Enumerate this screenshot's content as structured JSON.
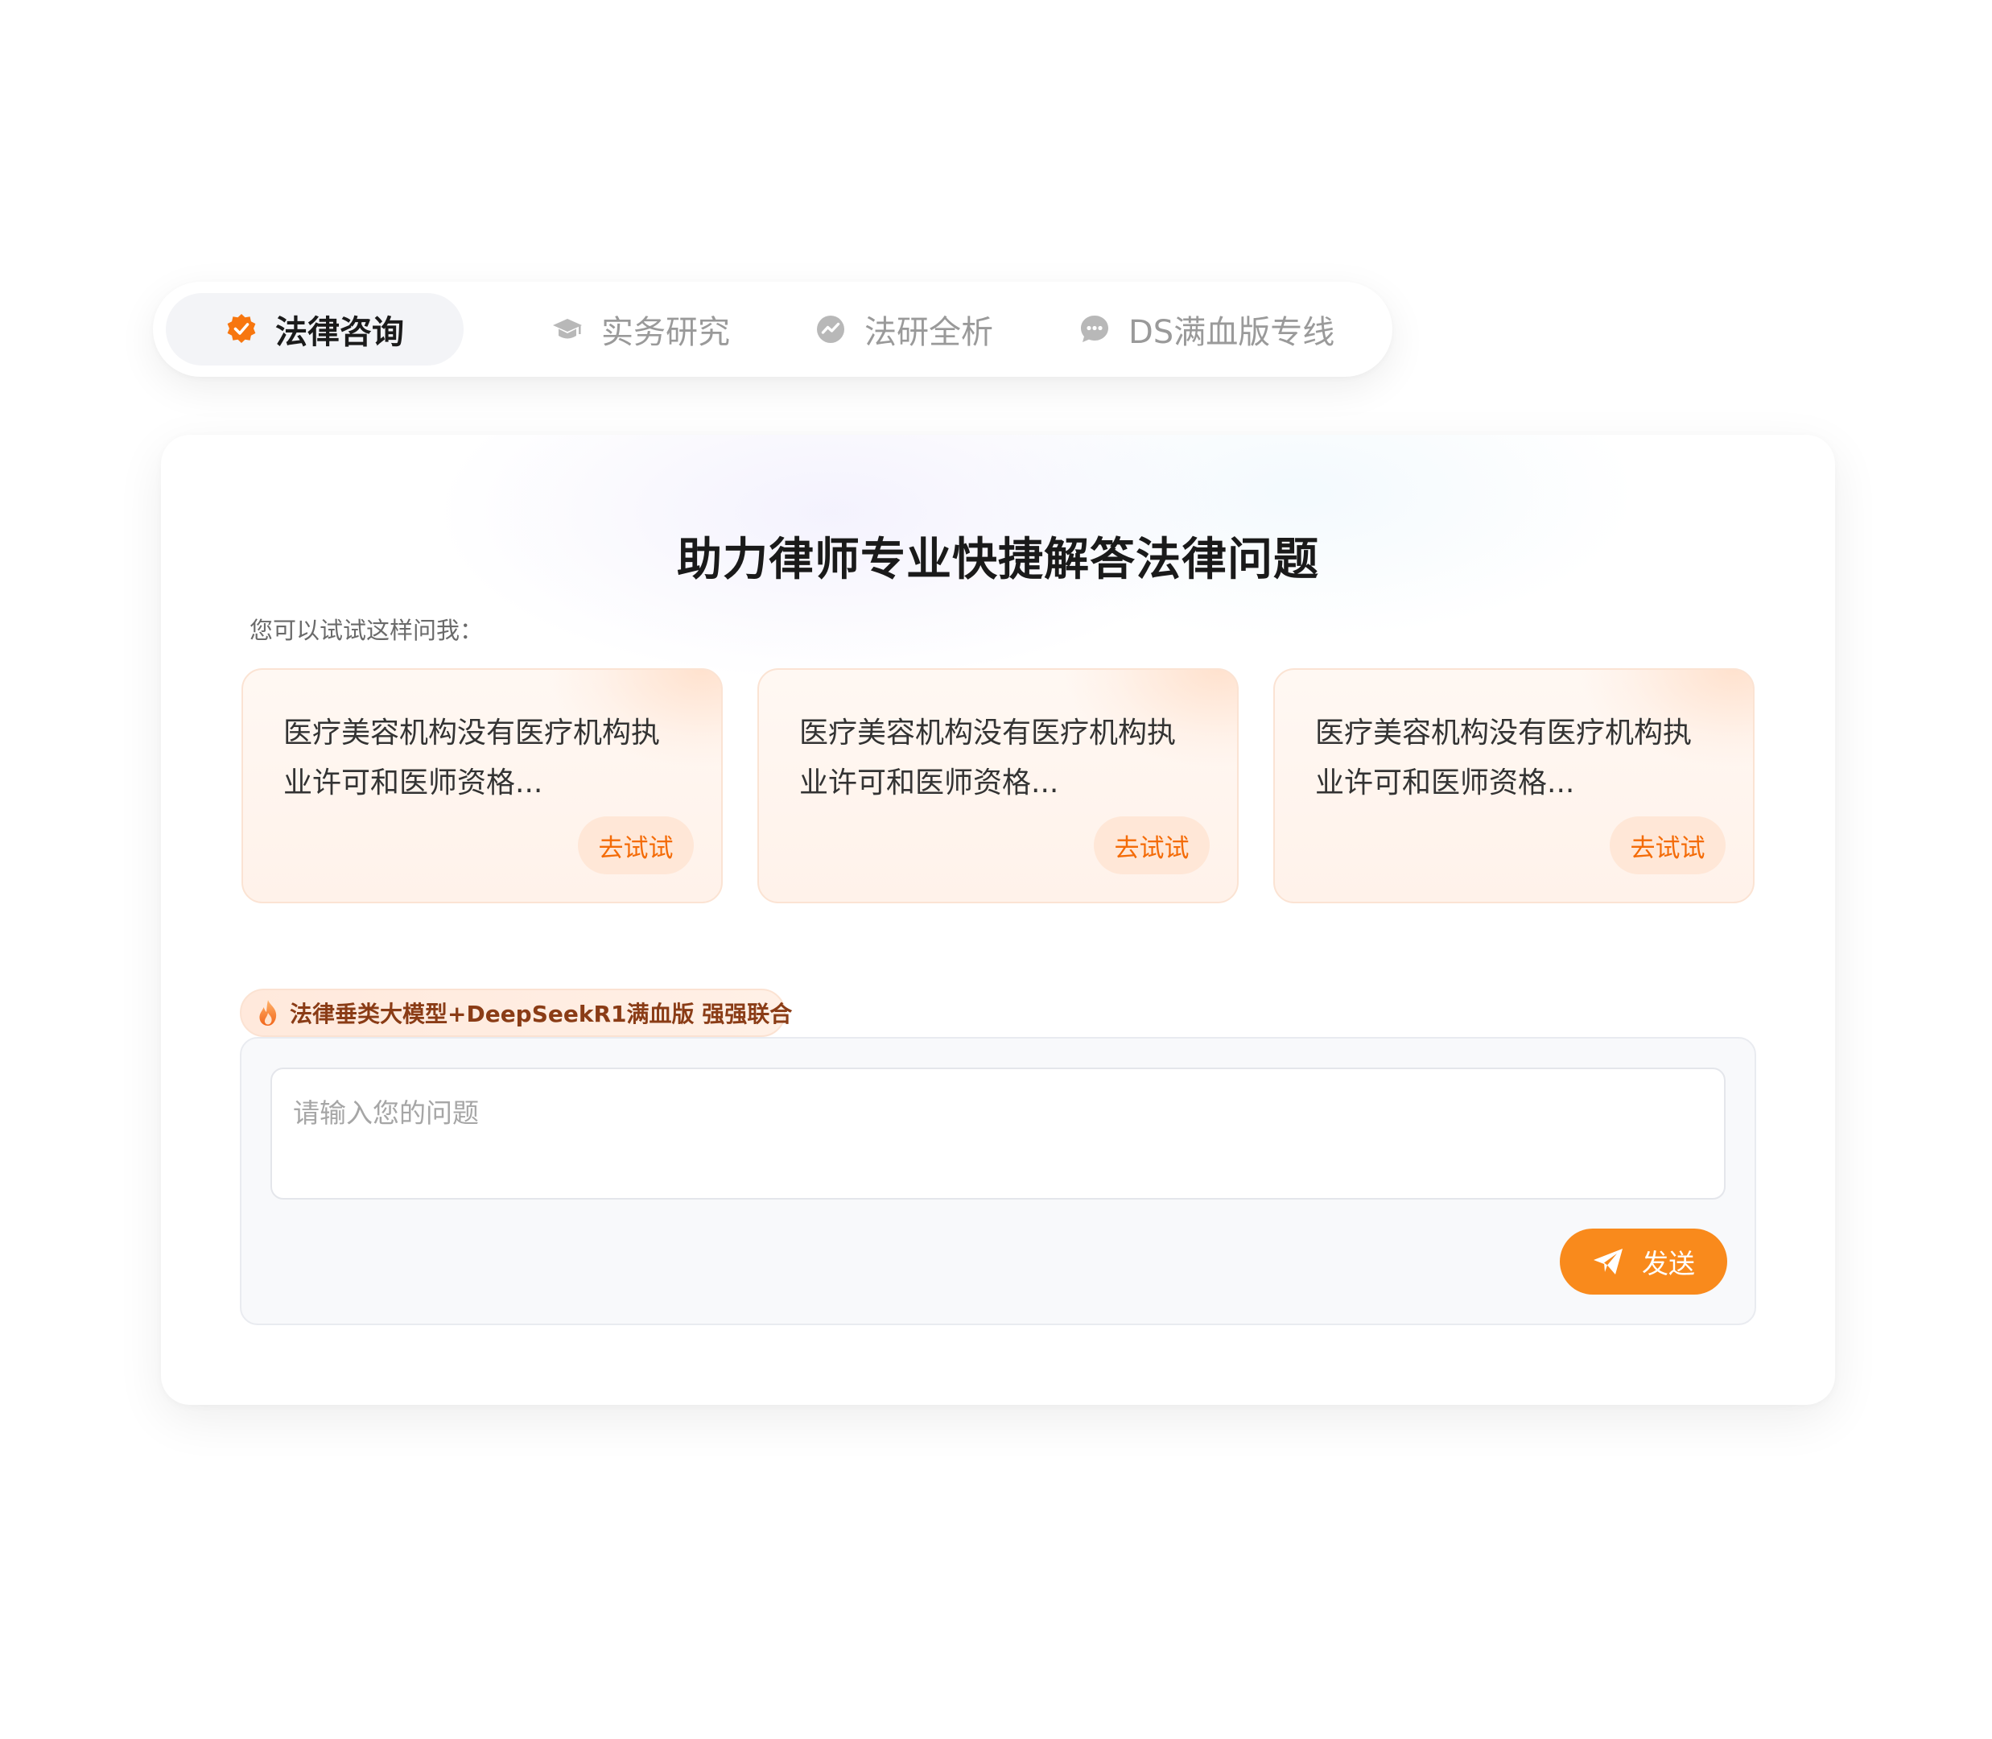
{
  "tabs": [
    {
      "label": "法律咨询",
      "icon": "check-badge-icon",
      "active": true
    },
    {
      "label": "实务研究",
      "icon": "graduation-cap-icon",
      "active": false
    },
    {
      "label": "法研全析",
      "icon": "trend-chart-icon",
      "active": false
    },
    {
      "label": "DS满血版专线",
      "icon": "chat-bubble-icon",
      "active": false
    }
  ],
  "main": {
    "headline": "助力律师专业快捷解答法律问题",
    "hint": "您可以试试这样问我：",
    "suggestions": [
      {
        "text": "医疗美容机构没有医疗机构执业许可和医师资格...",
        "button": "去试试"
      },
      {
        "text": "医疗美容机构没有医疗机构执业许可和医师资格...",
        "button": "去试试"
      },
      {
        "text": "医疗美容机构没有医疗机构执业许可和医师资格...",
        "button": "去试试"
      }
    ],
    "badge": {
      "icon": "flame-icon",
      "text": "法律垂类大模型+DeepSeekR1满血版 强强联合"
    },
    "input": {
      "placeholder": "请输入您的问题",
      "value": ""
    },
    "send": {
      "label": "发送",
      "icon": "paper-plane-icon"
    }
  },
  "colors": {
    "accent": "#f98a1c",
    "accent_text": "#f46b07",
    "badge_text": "#8a3c16",
    "inactive_tab": "#9a9a9a"
  }
}
